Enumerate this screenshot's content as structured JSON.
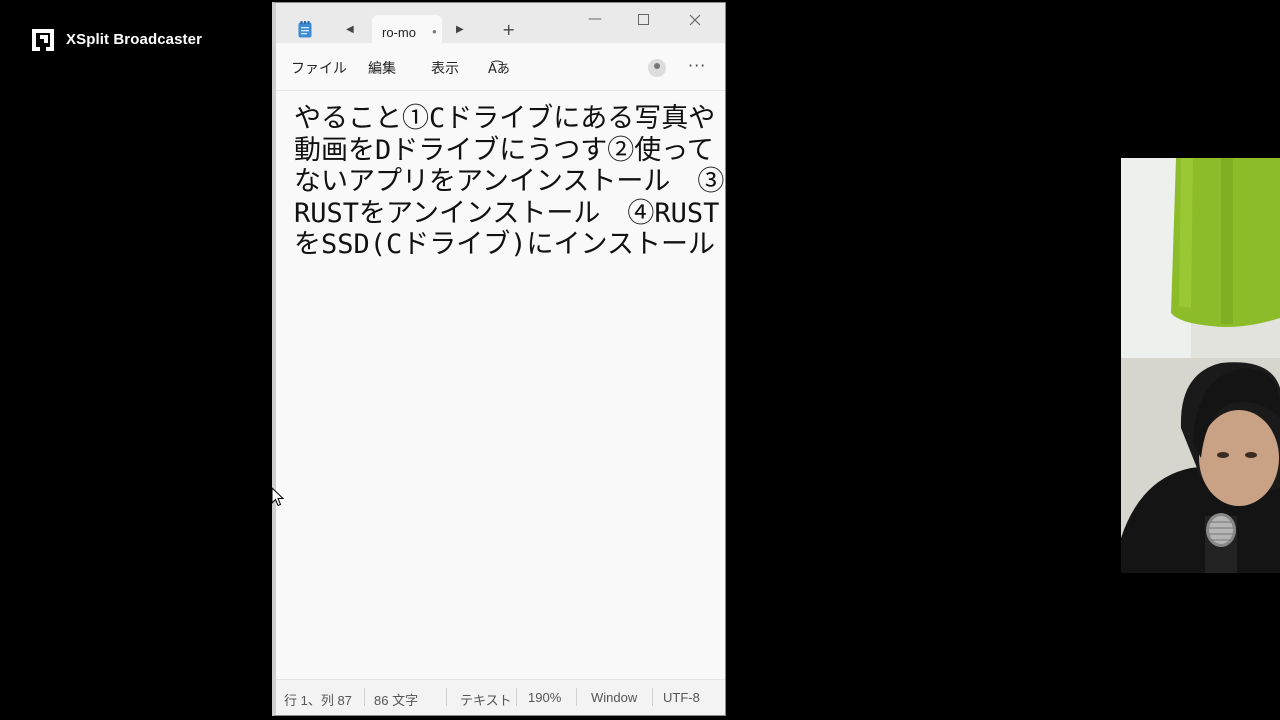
{
  "overlay": {
    "brand": "XSplit Broadcaster"
  },
  "window": {
    "tab_title": "ro-mo",
    "new_tab": "+",
    "controls": {
      "minimize": "—"
    }
  },
  "menu": {
    "file": "ファイル",
    "edit": "編集",
    "view": "表示",
    "font_icon": "A͡あ",
    "more": "···"
  },
  "editor": {
    "text": "やること①Cドライブにある写真や動画をDドライブにうつす②使ってないアプリをアンインストール　③RUSTをアンインストール　④RUSTをSSD(Cドライブ)にインストール"
  },
  "status": {
    "position": "行 1、列 87",
    "chars": "86 文字",
    "format": "テキスト",
    "zoom": "190%",
    "line_ending": "Window",
    "encoding": "UTF-8"
  },
  "colors": {
    "window_bg": "#f9f9f9",
    "titlebar_bg": "#eaeaea",
    "curtain": "#8cbc2a"
  },
  "icons": {
    "app": "notepad-icon",
    "prev": "chevron-left-icon",
    "next": "chevron-right-icon",
    "account": "account-icon",
    "more": "more-icon"
  }
}
